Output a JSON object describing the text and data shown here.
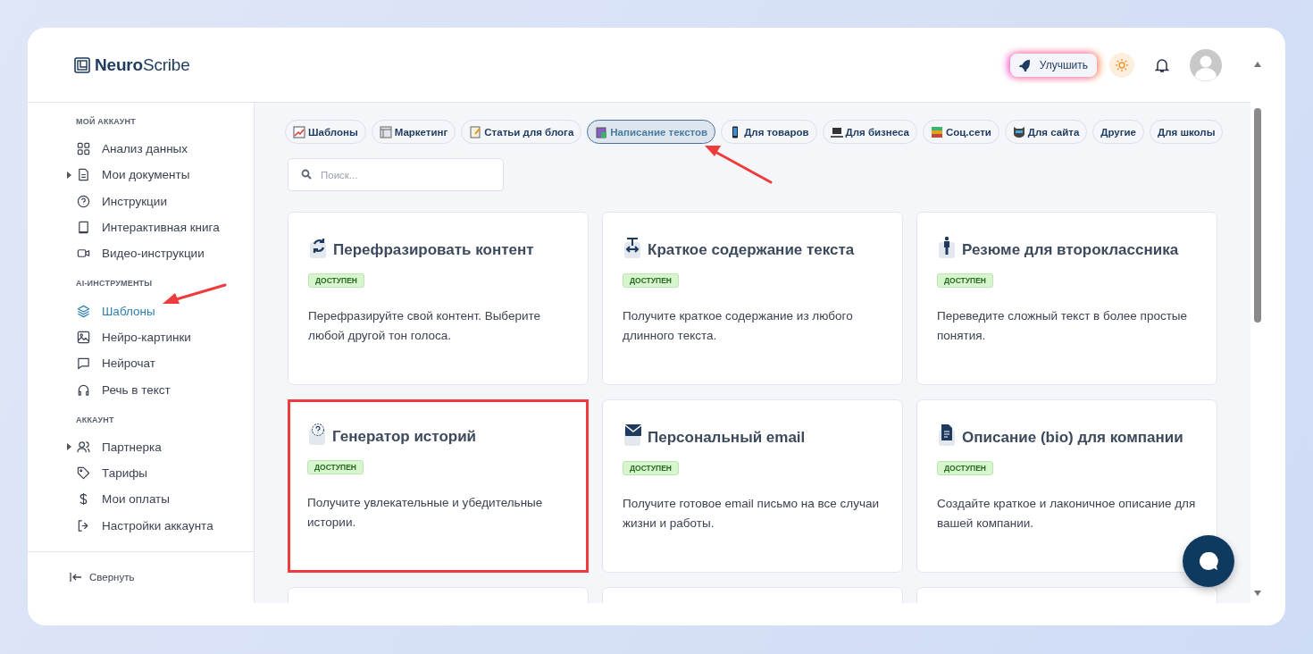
{
  "logo": {
    "bold": "Neuro",
    "light": "Scribe"
  },
  "header": {
    "upgrade_button": "Улучшить"
  },
  "sidebar": {
    "sections": [
      {
        "title": "МОЙ АККАУНТ",
        "items": [
          {
            "label": "Анализ данных",
            "selected": false,
            "expandable": false,
            "pointed": false
          },
          {
            "label": "Мои документы",
            "selected": false,
            "expandable": true,
            "pointed": false
          },
          {
            "label": "Инструкции",
            "selected": false,
            "expandable": false,
            "pointed": false
          },
          {
            "label": "Интерактивная книга",
            "selected": false,
            "expandable": false,
            "pointed": false
          },
          {
            "label": "Видео-инструкции",
            "selected": false,
            "expandable": false,
            "pointed": false
          }
        ]
      },
      {
        "title": "AI-ИНСТРУМЕНТЫ",
        "items": [
          {
            "label": "Шаблоны",
            "selected": true,
            "expandable": false,
            "pointed": true
          },
          {
            "label": "Нейро-картинки",
            "selected": false,
            "expandable": false,
            "pointed": false
          },
          {
            "label": "Нейрочат",
            "selected": false,
            "expandable": false,
            "pointed": false
          },
          {
            "label": "Речь в текст",
            "selected": false,
            "expandable": false,
            "pointed": false
          }
        ]
      },
      {
        "title": "АККАУНТ",
        "items": [
          {
            "label": "Партнерка",
            "selected": false,
            "expandable": true,
            "pointed": false
          },
          {
            "label": "Тарифы",
            "selected": false,
            "expandable": false,
            "pointed": false
          },
          {
            "label": "Мои оплаты",
            "selected": false,
            "expandable": false,
            "pointed": false
          },
          {
            "label": "Настройки аккаунта",
            "selected": false,
            "expandable": false,
            "pointed": false
          }
        ]
      }
    ],
    "collapse": "Свернуть"
  },
  "tabs": [
    {
      "label": "Шаблоны",
      "selected": false,
      "pointed": false
    },
    {
      "label": "Маркетинг",
      "selected": false,
      "pointed": false
    },
    {
      "label": "Статьи для блога",
      "selected": false,
      "pointed": false
    },
    {
      "label": "Написание текстов",
      "selected": true,
      "pointed": true
    },
    {
      "label": "Для товаров",
      "selected": false,
      "pointed": false
    },
    {
      "label": "Для бизнеса",
      "selected": false,
      "pointed": false
    },
    {
      "label": "Соц.сети",
      "selected": false,
      "pointed": false
    },
    {
      "label": "Для сайта",
      "selected": false,
      "pointed": false
    },
    {
      "label": "Другие",
      "selected": false,
      "pointed": false
    },
    {
      "label": "Для школы",
      "selected": false,
      "pointed": false
    }
  ],
  "search": {
    "placeholder": "Поиск..."
  },
  "cards": [
    {
      "title": "Перефразировать контент",
      "badge": "ДОСТУПЕН",
      "description": "Перефразируйте свой контент. Выберите любой другой тон голоса.",
      "highlighted": false
    },
    {
      "title": "Краткое содержание текста",
      "badge": "ДОСТУПЕН",
      "description": "Получите краткое содержание из любого длинного текста.",
      "highlighted": false
    },
    {
      "title": "Резюме для второклассника",
      "badge": "ДОСТУПЕН",
      "description": "Переведите сложный текст в более простые понятия.",
      "highlighted": false
    },
    {
      "title": "Генератор историй",
      "badge": "ДОСТУПЕН",
      "description": "Получите увлекательные и убедительные истории.",
      "highlighted": true
    },
    {
      "title": "Персональный email",
      "badge": "ДОСТУПЕН",
      "description": "Получите готовое email письмо на все случаи жизни и работы.",
      "highlighted": false
    },
    {
      "title": "Описание (bio) для компании",
      "badge": "ДОСТУПЕН",
      "description": "Создайте краткое и лаконичное описание для вашей компании.",
      "highlighted": false
    }
  ]
}
